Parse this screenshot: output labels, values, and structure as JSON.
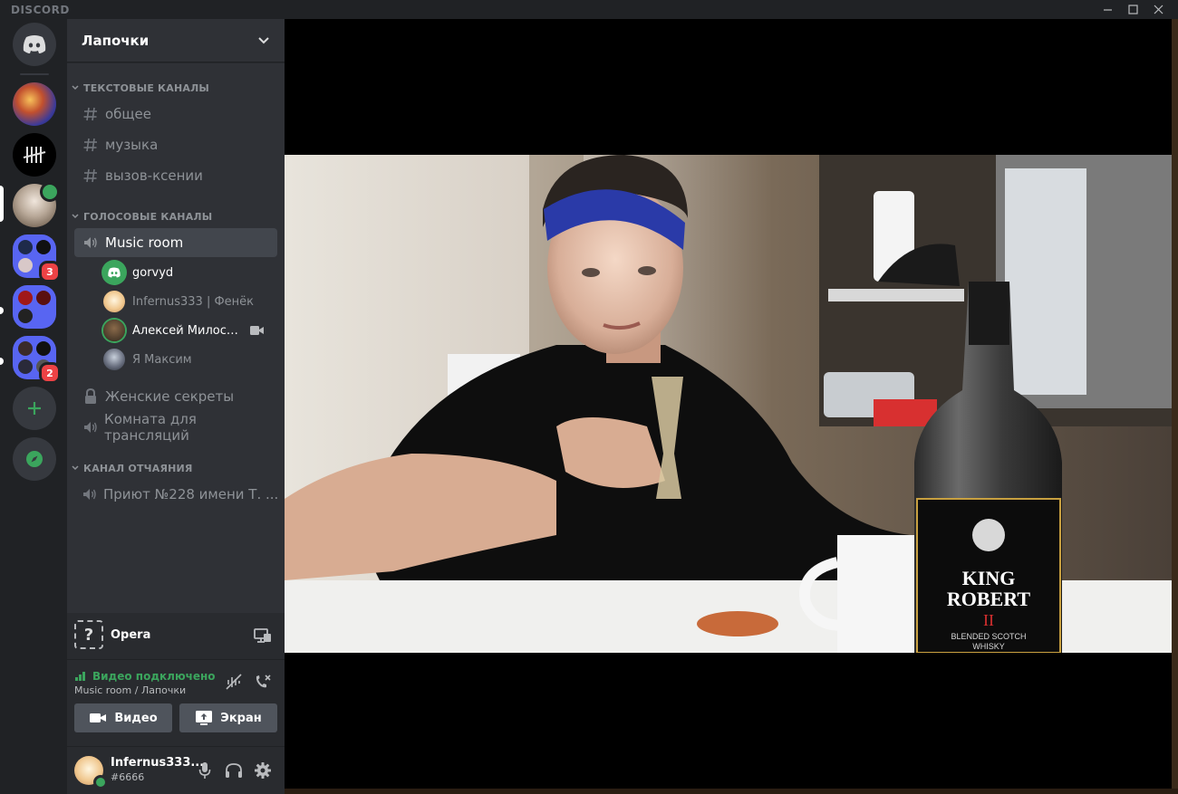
{
  "titlebar": {
    "brand": "DISCORD"
  },
  "servers": {
    "badges": [
      "3",
      "2"
    ]
  },
  "guild": {
    "name": "Лапочки"
  },
  "categories": {
    "text": "ТЕКСТОВЫЕ КАНАЛЫ",
    "voice": "ГОЛОСОВЫЕ КАНАЛЫ",
    "despair": "КАНАЛ ОТЧАЯНИЯ"
  },
  "text_channels": [
    "общее",
    "музыка",
    "вызов-ксении"
  ],
  "voice_channels": {
    "music_room": "Music room",
    "members": [
      {
        "name": "gorvyd"
      },
      {
        "name": "Infernus333 | Фенёк"
      },
      {
        "name": "Алексей Милосер..."
      },
      {
        "name": "Я Максим"
      }
    ],
    "locked": "Женские секреты",
    "stream_room": "Комната для трансляций"
  },
  "despair_channel": "Приют №228 имени Т. ...",
  "activity": {
    "name": "Opera"
  },
  "voice_panel": {
    "status": "Видео подключено",
    "location": "Music room / Лапочки",
    "video_label": "Видео",
    "screen_label": "Экран"
  },
  "user": {
    "name": "Infernus333...",
    "tag": "#6666"
  },
  "video": {
    "label_line1": "KING",
    "label_line2": "ROBERT",
    "label_line3": "II",
    "label_line4": "BLENDED SCOTCH",
    "label_line5": "WHISKY"
  },
  "colors": {
    "accent": "#5865f2",
    "green": "#3ba55d",
    "red": "#ed4245"
  }
}
